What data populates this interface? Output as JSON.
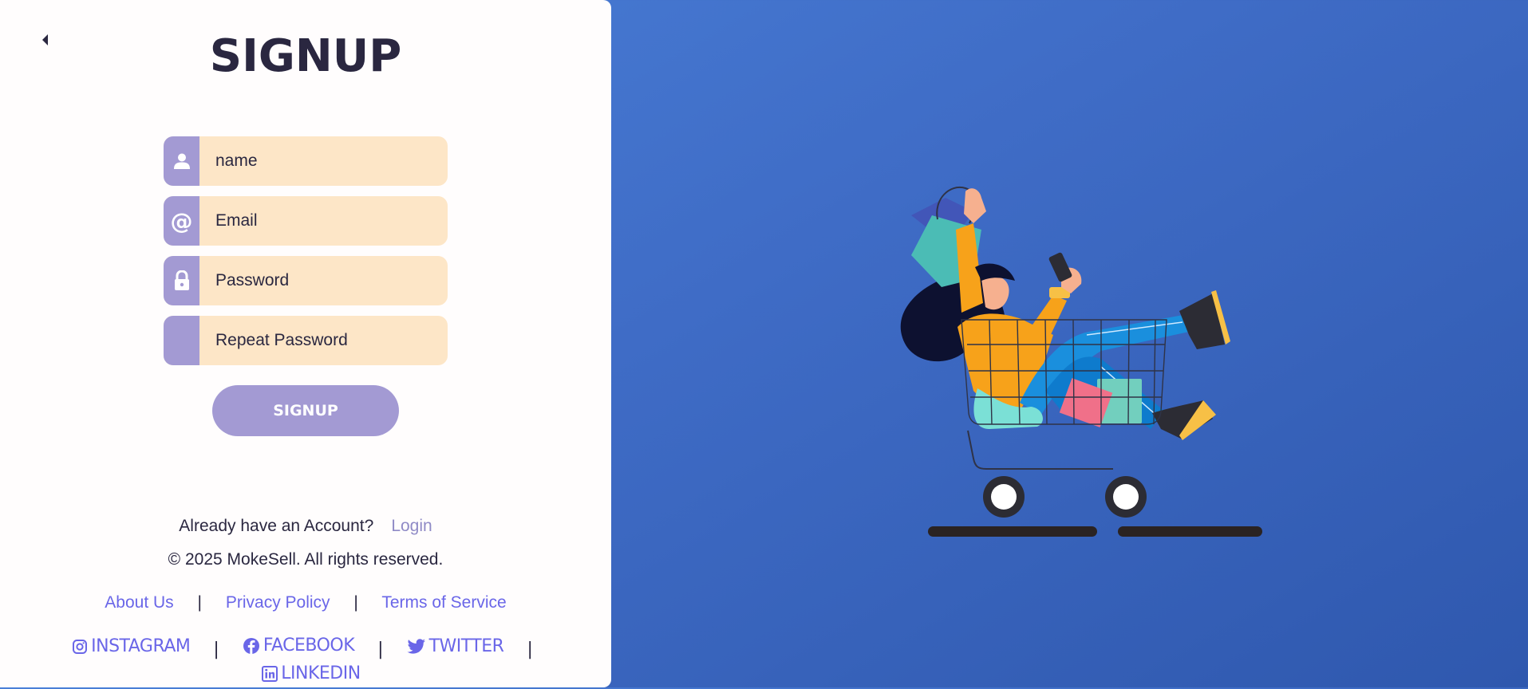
{
  "header": {
    "title": "SIGNUP"
  },
  "form": {
    "name_placeholder": "name",
    "email_placeholder": "Email",
    "password_placeholder": "Password",
    "repeat_placeholder": "Repeat Password",
    "email_icon_glyph": "@",
    "submit_label": "SIGNUP"
  },
  "account": {
    "prompt": "Already have an Account?",
    "login_label": "Login"
  },
  "footer": {
    "copyright": "© 2025 MokeSell. All rights reserved.",
    "links": [
      "About Us",
      "Privacy Policy",
      "Terms of Service"
    ],
    "separator": "|",
    "social": [
      "INSTAGRAM",
      "FACEBOOK",
      "TWITTER",
      "LINKEDIN"
    ]
  },
  "colors": {
    "accent": "#a39ad3",
    "field_bg": "#fde6c7",
    "link": "#6a66e8",
    "background_blue": "#3f6cc6",
    "text": "#2a2740"
  },
  "icons": {
    "back": "caret-left-icon",
    "name": "user-icon",
    "email": "at-icon",
    "password": "lock-icon",
    "instagram": "instagram-icon",
    "facebook": "facebook-icon",
    "twitter": "twitter-icon",
    "linkedin": "linkedin-icon"
  }
}
